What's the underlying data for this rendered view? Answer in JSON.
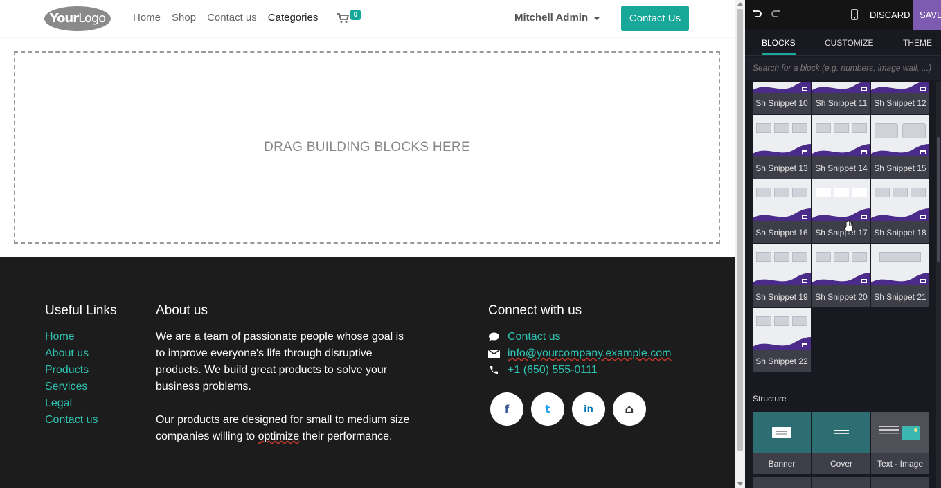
{
  "navbar": {
    "logo_text_bold": "Your",
    "logo_text_light": "Logo",
    "menu": [
      "Home",
      "Shop",
      "Contact us",
      "Categories"
    ],
    "active_menu": "Categories",
    "cart_count": "0",
    "user_name": "Mitchell Admin",
    "contact_button": "Contact Us"
  },
  "main": {
    "dropzone_text": "DRAG BUILDING BLOCKS HERE"
  },
  "footer": {
    "useful_links_title": "Useful Links",
    "useful_links": [
      "Home",
      "About us",
      "Products",
      "Services",
      "Legal",
      "Contact us"
    ],
    "about_title": "About us",
    "about_p1": "We are a team of passionate people whose goal is to improve everyone's life through disruptive products. We build great products to solve your business problems.",
    "about_p2_before": "Our products are designed for small to medium size companies willing to ",
    "about_p2_underlined": "optimize",
    "about_p2_after": " their performance.",
    "connect_title": "Connect with us",
    "contact_link": "Contact us",
    "email": "info@yourcompany.example.com",
    "phone": "+1 (650) 555-0111",
    "social": [
      {
        "icon": "facebook-icon",
        "glyph": "f"
      },
      {
        "icon": "twitter-icon",
        "glyph": "t"
      },
      {
        "icon": "linkedin-icon",
        "glyph": "in"
      },
      {
        "icon": "home-icon",
        "glyph": "⌂"
      }
    ]
  },
  "editor": {
    "discard_label": "DISCARD",
    "save_label": "SAVE",
    "tabs": [
      "BLOCKS",
      "CUSTOMIZE",
      "THEME"
    ],
    "active_tab": "BLOCKS",
    "search_placeholder": "Search for a block (e.g. numbers, image wall, ...)",
    "snippets": [
      "Sh Snippet 10",
      "Sh Snippet 11",
      "Sh Snippet 12",
      "Sh Snippet 13",
      "Sh Snippet 14",
      "Sh Snippet 15",
      "Sh Snippet 16",
      "Sh Snippet 17",
      "Sh Snippet 18",
      "Sh Snippet 19",
      "Sh Snippet 20",
      "Sh Snippet 21",
      "Sh Snippet 22"
    ],
    "structure_title": "Structure",
    "structure_blocks": [
      "Banner",
      "Cover",
      "Text - Image"
    ]
  },
  "colors": {
    "accent": "#17a89a",
    "link": "#2fc4b2",
    "footer_bg": "#1c1c1c",
    "panel_bg": "#191922",
    "save_bg": "#7c5bb0",
    "snippet_wave": "#4b2b8a"
  }
}
